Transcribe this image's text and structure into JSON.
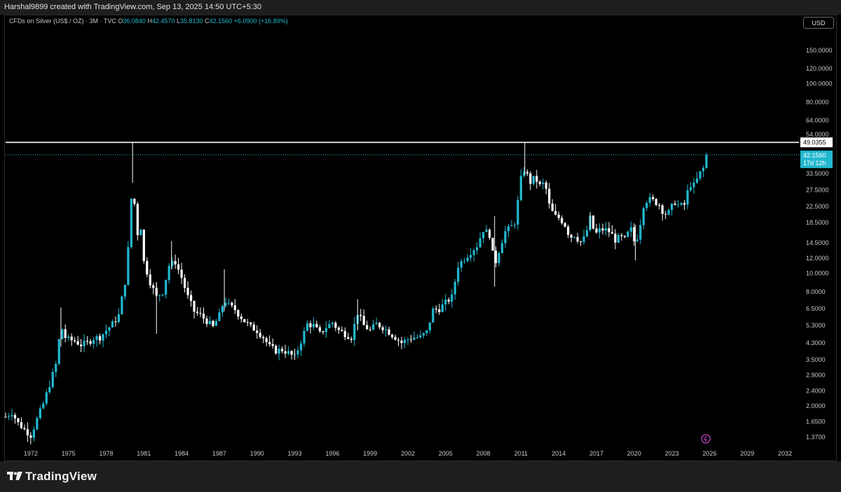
{
  "header": {
    "credit": "Harshal9899 created with TradingView.com, Sep 13, 2025 14:50 UTC+5:30"
  },
  "legend": {
    "symbol": "CFDs on Silver (US$ / OZ) · 3M · TVC",
    "open_label": "O",
    "open": "36.0840",
    "high_label": "H",
    "high": "42.4570",
    "low_label": "L",
    "low": "35.8130",
    "close_label": "C",
    "close": "42.1560",
    "change": "+6.0900 (+16.89%)"
  },
  "currency_button": "USD",
  "footer": {
    "brand": "TradingView"
  },
  "colors": {
    "up": "#22b8cf",
    "down": "#ffffff",
    "background": "#000000",
    "accent": "#22b8cf"
  },
  "chart_data": {
    "type": "candlestick",
    "interval": "3M",
    "y_scale": "log",
    "ylim": [
      1.2,
      190
    ],
    "xlim": [
      1970.0,
      2033.0
    ],
    "y_ticks": [
      "1.3700",
      "1.6500",
      "2.0000",
      "2.4000",
      "2.9000",
      "3.5000",
      "4.3000",
      "5.3000",
      "6.5000",
      "8.0000",
      "10.0000",
      "12.0000",
      "14.5000",
      "18.5000",
      "22.5000",
      "27.5000",
      "33.5000",
      "54.0000",
      "64.0000",
      "80.0000",
      "100.0000",
      "120.0000",
      "150.0000"
    ],
    "x_ticks": [
      "1972",
      "1975",
      "1978",
      "1981",
      "1984",
      "1987",
      "1990",
      "1993",
      "1996",
      "1999",
      "2002",
      "2005",
      "2008",
      "2011",
      "2014",
      "2017",
      "2020",
      "2023",
      "2026",
      "2029",
      "2032"
    ],
    "horizontal_line": {
      "value": 49.0355,
      "label": "49.0355"
    },
    "last_price": {
      "value": 42.156,
      "label": "42.1560",
      "countdown": "17d 12h"
    },
    "grid": false,
    "close_path": [
      [
        1970.0,
        1.75
      ],
      [
        1970.5,
        1.85
      ],
      [
        1971.0,
        1.62
      ],
      [
        1971.5,
        1.5
      ],
      [
        1972.0,
        1.4
      ],
      [
        1972.5,
        1.7
      ],
      [
        1973.0,
        2.05
      ],
      [
        1973.5,
        2.6
      ],
      [
        1974.0,
        3.3
      ],
      [
        1974.4,
        5.3
      ],
      [
        1974.8,
        4.5
      ],
      [
        1975.5,
        4.4
      ],
      [
        1976.0,
        4.2
      ],
      [
        1976.5,
        4.3
      ],
      [
        1977.0,
        4.55
      ],
      [
        1977.5,
        4.6
      ],
      [
        1978.0,
        5.0
      ],
      [
        1978.5,
        5.4
      ],
      [
        1979.0,
        6.0
      ],
      [
        1979.5,
        9.0
      ],
      [
        1979.9,
        17.0
      ],
      [
        1980.1,
        36.0
      ],
      [
        1980.4,
        15.0
      ],
      [
        1980.7,
        19.0
      ],
      [
        1981.0,
        11.5
      ],
      [
        1981.5,
        9.0
      ],
      [
        1982.0,
        7.5
      ],
      [
        1982.5,
        8.0
      ],
      [
        1983.0,
        11.0
      ],
      [
        1983.5,
        11.5
      ],
      [
        1984.0,
        9.5
      ],
      [
        1984.5,
        7.5
      ],
      [
        1985.0,
        6.3
      ],
      [
        1985.5,
        6.0
      ],
      [
        1986.0,
        5.6
      ],
      [
        1986.5,
        5.2
      ],
      [
        1987.0,
        6.0
      ],
      [
        1987.4,
        7.3
      ],
      [
        1987.8,
        6.7
      ],
      [
        1988.2,
        6.5
      ],
      [
        1988.6,
        6.0
      ],
      [
        1989.0,
        5.6
      ],
      [
        1989.5,
        5.2
      ],
      [
        1990.0,
        5.0
      ],
      [
        1990.5,
        4.6
      ],
      [
        1991.0,
        4.1
      ],
      [
        1991.5,
        3.9
      ],
      [
        1992.0,
        3.95
      ],
      [
        1992.5,
        3.8
      ],
      [
        1993.0,
        3.6
      ],
      [
        1993.5,
        4.4
      ],
      [
        1994.0,
        5.4
      ],
      [
        1994.5,
        5.3
      ],
      [
        1995.0,
        4.8
      ],
      [
        1995.5,
        5.2
      ],
      [
        1996.0,
        5.5
      ],
      [
        1996.5,
        5.0
      ],
      [
        1997.0,
        4.8
      ],
      [
        1997.5,
        4.6
      ],
      [
        1998.0,
        6.2
      ],
      [
        1998.5,
        5.3
      ],
      [
        1999.0,
        5.0
      ],
      [
        1999.5,
        5.4
      ],
      [
        2000.0,
        5.2
      ],
      [
        2000.5,
        4.9
      ],
      [
        2001.0,
        4.6
      ],
      [
        2001.5,
        4.3
      ],
      [
        2002.0,
        4.5
      ],
      [
        2002.5,
        4.6
      ],
      [
        2003.0,
        4.6
      ],
      [
        2003.5,
        4.9
      ],
      [
        2004.0,
        6.4
      ],
      [
        2004.5,
        6.5
      ],
      [
        2005.0,
        7.0
      ],
      [
        2005.5,
        7.5
      ],
      [
        2006.0,
        11.0
      ],
      [
        2006.5,
        12.0
      ],
      [
        2007.0,
        13.0
      ],
      [
        2007.5,
        14.0
      ],
      [
        2008.0,
        17.0
      ],
      [
        2008.5,
        16.0
      ],
      [
        2008.9,
        11.0
      ],
      [
        2009.3,
        13.5
      ],
      [
        2009.7,
        16.5
      ],
      [
        2010.2,
        17.5
      ],
      [
        2010.6,
        19.0
      ],
      [
        2010.9,
        30.0
      ],
      [
        2011.3,
        36.0
      ],
      [
        2011.7,
        30.0
      ],
      [
        2012.1,
        32.0
      ],
      [
        2012.5,
        29.0
      ],
      [
        2012.9,
        30.0
      ],
      [
        2013.3,
        22.0
      ],
      [
        2013.7,
        20.0
      ],
      [
        2014.1,
        19.5
      ],
      [
        2014.5,
        18.0
      ],
      [
        2014.9,
        15.5
      ],
      [
        2015.3,
        16.0
      ],
      [
        2015.7,
        14.5
      ],
      [
        2016.1,
        15.5
      ],
      [
        2016.5,
        19.5
      ],
      [
        2016.9,
        16.0
      ],
      [
        2017.3,
        17.0
      ],
      [
        2017.7,
        17.0
      ],
      [
        2018.1,
        16.5
      ],
      [
        2018.5,
        15.0
      ],
      [
        2018.9,
        15.5
      ],
      [
        2019.3,
        15.0
      ],
      [
        2019.7,
        17.5
      ],
      [
        2020.1,
        14.0
      ],
      [
        2020.5,
        18.5
      ],
      [
        2020.8,
        24.0
      ],
      [
        2021.2,
        24.5
      ],
      [
        2021.6,
        24.0
      ],
      [
        2022.0,
        23.0
      ],
      [
        2022.4,
        20.5
      ],
      [
        2022.8,
        21.0
      ],
      [
        2023.2,
        24.0
      ],
      [
        2023.6,
        22.5
      ],
      [
        2024.0,
        23.0
      ],
      [
        2024.4,
        29.5
      ],
      [
        2024.8,
        29.0
      ],
      [
        2025.2,
        33.5
      ],
      [
        2025.55,
        36.1
      ],
      [
        2025.75,
        42.156
      ]
    ],
    "spikes": [
      [
        1980.1,
        49.0355,
        30.0
      ],
      [
        2011.3,
        49.0355,
        33.0
      ],
      [
        2008.9,
        20.0,
        8.5
      ],
      [
        2020.1,
        18.0,
        11.7
      ],
      [
        1982.0,
        9.0,
        4.8
      ],
      [
        1983.2,
        14.8,
        10.5
      ],
      [
        1987.4,
        10.5,
        6.3
      ],
      [
        1998.0,
        7.3,
        5.0
      ],
      [
        2016.5,
        21.0,
        17.0
      ],
      [
        1974.4,
        6.6,
        4.1
      ],
      [
        1993.0,
        4.0,
        3.5
      ]
    ]
  }
}
